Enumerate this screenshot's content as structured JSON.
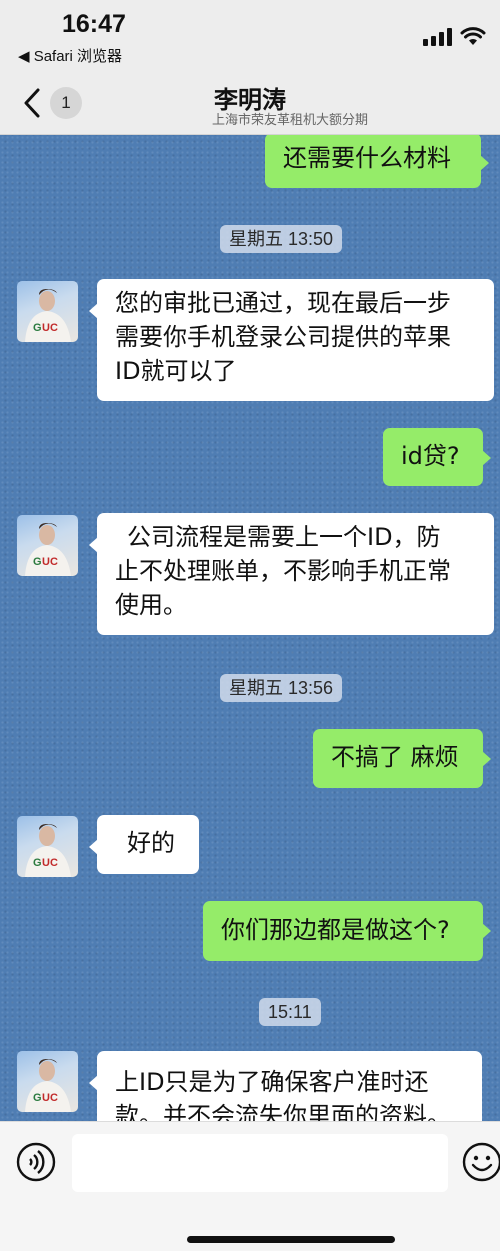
{
  "status_bar": {
    "time": "16:47",
    "back_app": "◀ Safari 浏览器"
  },
  "header": {
    "unread_count": "1",
    "title": "李明涛",
    "subtitle": "上海市荣友革租机大额分期"
  },
  "messages": [
    {
      "type": "out",
      "text": "还需要什么材料"
    },
    {
      "type": "timestamp",
      "text": "星期五 13:50"
    },
    {
      "type": "in",
      "lines": [
        "您的审批已通过，现在最后一步",
        "需要你手机登录公司提供的苹果",
        "ID就可以了"
      ]
    },
    {
      "type": "out",
      "text": "id贷?"
    },
    {
      "type": "in",
      "lines": [
        "公司流程是需要上一个ID，防",
        "止不处理账单，不影响手机正常",
        "使用。"
      ]
    },
    {
      "type": "timestamp",
      "text": "星期五 13:56"
    },
    {
      "type": "out",
      "text": "不搞了 麻烦"
    },
    {
      "type": "in",
      "text": "好的"
    },
    {
      "type": "out",
      "text": "你们那边都是做这个?"
    },
    {
      "type": "timestamp",
      "text": "15:11"
    },
    {
      "type": "in",
      "lines": [
        "上ID只是为了确保客户准时还",
        "款。并不会流失你里面的资料。"
      ]
    }
  ],
  "input_bar": {
    "value": "",
    "placeholder": ""
  },
  "icons": {
    "voice": "voice-icon",
    "emoji": "emoji-icon",
    "back": "chevron-left-icon",
    "signal": "signal-icon",
    "wifi": "wifi-icon"
  },
  "colors": {
    "header_bg": "#ededed",
    "chat_bg": "#4f7db3",
    "outgoing_bubble": "#95ec69",
    "incoming_bubble": "#ffffff",
    "timestamp_bg": "#cdd8e9"
  }
}
